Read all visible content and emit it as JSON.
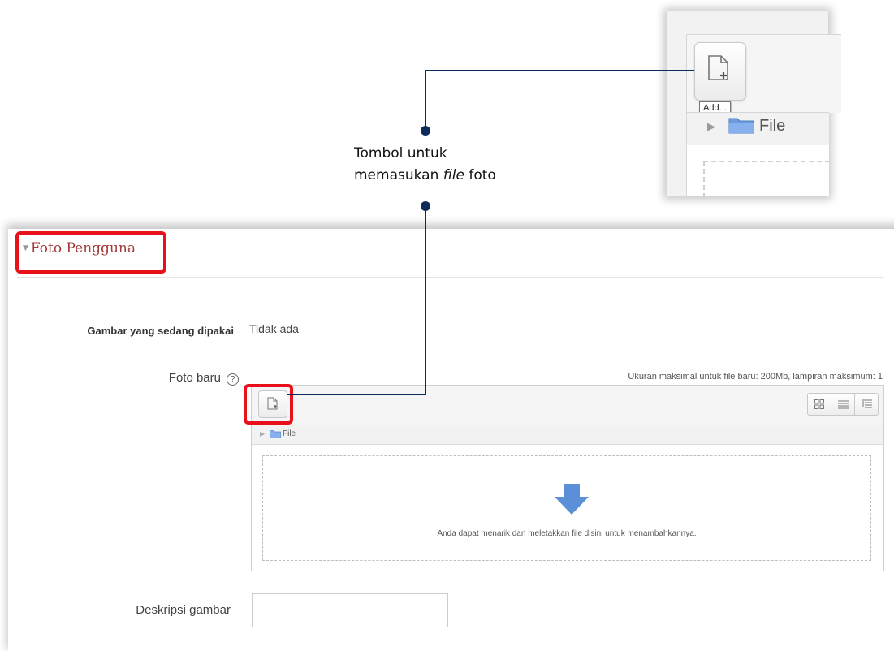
{
  "zoom": {
    "tooltip": "Add...",
    "folder_label": "File",
    "icons": [
      "add-file-icon",
      "folder-icon",
      "expand-arrow-icon"
    ]
  },
  "callout": {
    "line1": "Tombol untuk",
    "line2_prefix": "memasukan ",
    "line2_italic": "file",
    "line2_suffix": " foto"
  },
  "section": {
    "title": "Foto Pengguna"
  },
  "form": {
    "current_image_label": "Gambar yang sedang dipakai",
    "current_image_value": "Tidak ada",
    "new_photo_label": "Foto baru",
    "help_glyph": "?",
    "max_size_text": "Ukuran maksimal untuk file baru: 200Mb, lampiran maksimum: 1",
    "path_folder": "File",
    "drop_text": "Anda dapat menarik dan meletakkan file disini untuk menambahkannya.",
    "description_label": "Deskripsi gambar",
    "description_value": ""
  },
  "colors": {
    "highlight": "#e8101a",
    "callout": "#0d2a5a",
    "section_title": "#a33a3a",
    "drop_arrow": "#5b8fd8"
  }
}
